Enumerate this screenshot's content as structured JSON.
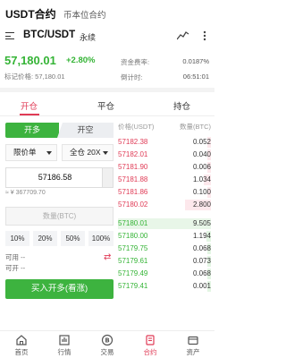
{
  "header": {
    "tab_usdt": "USDT合约",
    "tab_coin": "币本位合约",
    "symbol": "BTC/USDT",
    "contract_type": "永续"
  },
  "ticker": {
    "last_price": "57,180.01",
    "change": "+2.80%",
    "mark_price": "标记价格: 57,180.01",
    "funding_label": "资金费率:",
    "funding_value": "0.0187%",
    "countdown_label": "倒计时:",
    "countdown_value": "06:51:01"
  },
  "position_tabs": [
    {
      "label": "开仓"
    },
    {
      "label": "平仓"
    },
    {
      "label": "持仓"
    }
  ],
  "order_form": {
    "long_label": "开多",
    "short_label": "开空",
    "order_type": "限价单",
    "leverage": "全仓 20X",
    "price": "57186.58",
    "approx": "≈ ¥ 367709.70",
    "qty_placeholder": "数量(BTC)",
    "pct": [
      "10%",
      "20%",
      "50%",
      "100%"
    ],
    "available": "可用 --",
    "openable": "可开 --",
    "buy_button": "买入开多(看涨)"
  },
  "orderbook": {
    "price_header": "价格(USDT)",
    "qty_header": "数量(BTC)",
    "asks": [
      {
        "price": "57182.38",
        "qty": "0.052",
        "depth": 0.02
      },
      {
        "price": "57182.01",
        "qty": "0.040",
        "depth": 0.02
      },
      {
        "price": "57181.90",
        "qty": "0.006",
        "depth": 0.01
      },
      {
        "price": "57181.88",
        "qty": "1.034",
        "depth": 0.08
      },
      {
        "price": "57181.86",
        "qty": "0.100",
        "depth": 0.02
      },
      {
        "price": "57180.02",
        "qty": "2.800",
        "depth": 0.28
      }
    ],
    "bids": [
      {
        "price": "57180.01",
        "qty": "9.505",
        "depth": 1.0
      },
      {
        "price": "57180.00",
        "qty": "1.194",
        "depth": 0.05
      },
      {
        "price": "57179.75",
        "qty": "0.068",
        "depth": 0.02
      },
      {
        "price": "57179.61",
        "qty": "0.073",
        "depth": 0.02
      },
      {
        "price": "57179.49",
        "qty": "0.068",
        "depth": 0.02
      },
      {
        "price": "57179.41",
        "qty": "0.001",
        "depth": 0.01
      }
    ]
  },
  "nav": [
    {
      "label": "首页",
      "icon": "home-icon"
    },
    {
      "label": "行情",
      "icon": "market-icon"
    },
    {
      "label": "交易",
      "icon": "trade-icon"
    },
    {
      "label": "合约",
      "icon": "contract-icon"
    },
    {
      "label": "资产",
      "icon": "assets-icon"
    }
  ],
  "colors": {
    "green": "#35b436",
    "red": "#e03b56"
  }
}
